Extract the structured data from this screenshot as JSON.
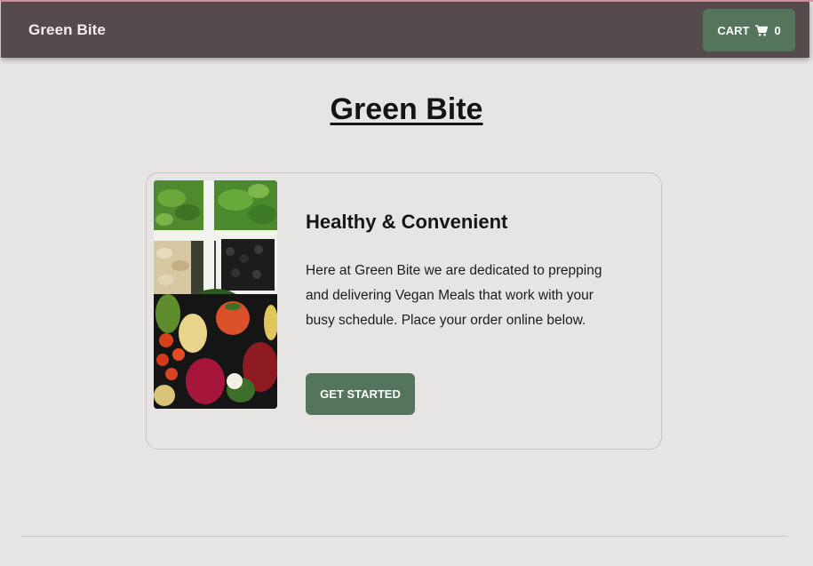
{
  "navbar": {
    "brand": "Green Bite",
    "cart_label": "CART",
    "cart_count": "0",
    "cart_icon": "shopping-cart-icon"
  },
  "main": {
    "title": "Green Bite"
  },
  "card": {
    "image": "vegetables-bowls-image",
    "heading": "Healthy & Convenient",
    "text": "Here at Green Bite we are dedicated to prepping and delivering Vegan Meals that work with your busy schedule. Place your order online below.",
    "cta_label": "GET STARTED"
  },
  "colors": {
    "navbar": "#554b4c",
    "accent": "#54755b",
    "background": "#e7e5e3"
  }
}
